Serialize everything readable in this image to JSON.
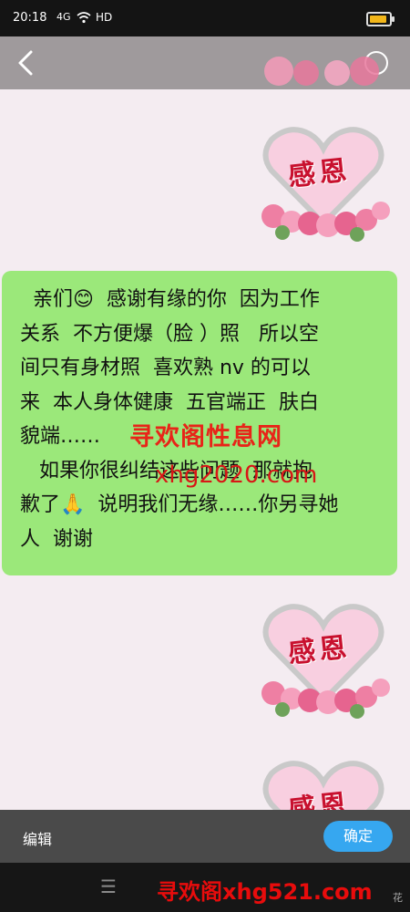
{
  "status_bar": {
    "time": "20:18",
    "signal": "4G",
    "network": "HD",
    "battery_level": 0.75,
    "battery_color": "#f2b61a"
  },
  "top_bar": {
    "back_icon": "chevron-left-icon",
    "more_icon": "circle-icon"
  },
  "decor": {
    "heart_text": "感恩"
  },
  "message": {
    "lines": [
      "  亲们😊  感谢有缘的你  因为工作",
      "关系  不方便爆（脸 ）照   所以空",
      "间只有身材照  喜欢熟 nv 的可以",
      "来  本人身体健康  五官端正  肤白",
      "貌端……",
      "   如果你很纠结这些问题  那就抱",
      "歉了🙏  说明我们无缘……你另寻她",
      "人  谢谢"
    ]
  },
  "watermarks": {
    "site_name": "寻欢阁性息网",
    "site_url": "xhg2020.com",
    "footer": "寻欢阁xhg521.com",
    "corner": "花"
  },
  "bottom_bar": {
    "edit_label": "编辑",
    "confirm_label": "确定",
    "confirm_color": "#36a7f0"
  },
  "nav_bar": {
    "menu_icon": "menu-icon"
  }
}
